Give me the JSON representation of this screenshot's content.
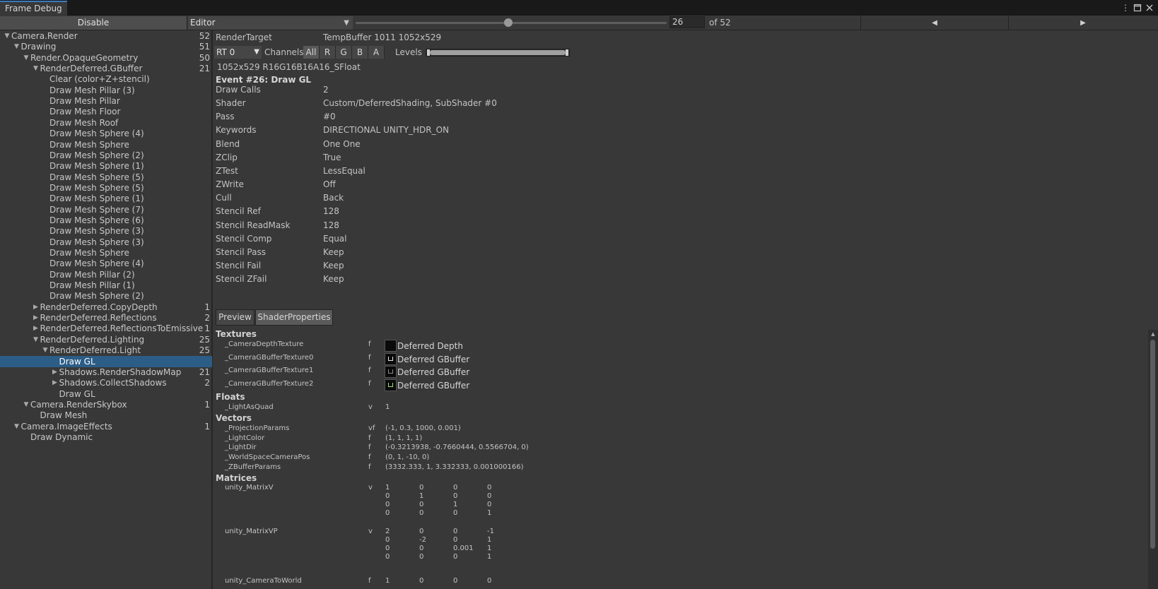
{
  "window": {
    "tab_title": "Frame Debug",
    "icons": [
      "more-vert-icon",
      "maximize-icon",
      "close-icon"
    ]
  },
  "toolbar": {
    "disable_label": "Disable",
    "target_value": "Editor",
    "event_value": "26",
    "event_of": "of 52",
    "slider_fraction": 0.5
  },
  "tree": [
    {
      "label": "Camera.Render",
      "count": "52",
      "depth": 0,
      "arrow": "down"
    },
    {
      "label": "Drawing",
      "count": "51",
      "depth": 1,
      "arrow": "down"
    },
    {
      "label": "Render.OpaqueGeometry",
      "count": "50",
      "depth": 2,
      "arrow": "down"
    },
    {
      "label": "RenderDeferred.GBuffer",
      "count": "21",
      "depth": 3,
      "arrow": "down"
    },
    {
      "label": "Clear (color+Z+stencil)",
      "count": "",
      "depth": 4,
      "arrow": ""
    },
    {
      "label": "Draw Mesh Pillar (3)",
      "count": "",
      "depth": 4,
      "arrow": ""
    },
    {
      "label": "Draw Mesh Pillar",
      "count": "",
      "depth": 4,
      "arrow": ""
    },
    {
      "label": "Draw Mesh Floor",
      "count": "",
      "depth": 4,
      "arrow": ""
    },
    {
      "label": "Draw Mesh Roof",
      "count": "",
      "depth": 4,
      "arrow": ""
    },
    {
      "label": "Draw Mesh Sphere (4)",
      "count": "",
      "depth": 4,
      "arrow": ""
    },
    {
      "label": "Draw Mesh Sphere",
      "count": "",
      "depth": 4,
      "arrow": ""
    },
    {
      "label": "Draw Mesh Sphere (2)",
      "count": "",
      "depth": 4,
      "arrow": ""
    },
    {
      "label": "Draw Mesh Sphere (1)",
      "count": "",
      "depth": 4,
      "arrow": ""
    },
    {
      "label": "Draw Mesh Sphere (5)",
      "count": "",
      "depth": 4,
      "arrow": ""
    },
    {
      "label": "Draw Mesh Sphere (5)",
      "count": "",
      "depth": 4,
      "arrow": ""
    },
    {
      "label": "Draw Mesh Sphere (1)",
      "count": "",
      "depth": 4,
      "arrow": ""
    },
    {
      "label": "Draw Mesh Sphere (7)",
      "count": "",
      "depth": 4,
      "arrow": ""
    },
    {
      "label": "Draw Mesh Sphere (6)",
      "count": "",
      "depth": 4,
      "arrow": ""
    },
    {
      "label": "Draw Mesh Sphere (3)",
      "count": "",
      "depth": 4,
      "arrow": ""
    },
    {
      "label": "Draw Mesh Sphere (3)",
      "count": "",
      "depth": 4,
      "arrow": ""
    },
    {
      "label": "Draw Mesh Sphere",
      "count": "",
      "depth": 4,
      "arrow": ""
    },
    {
      "label": "Draw Mesh Sphere (4)",
      "count": "",
      "depth": 4,
      "arrow": ""
    },
    {
      "label": "Draw Mesh Pillar (2)",
      "count": "",
      "depth": 4,
      "arrow": ""
    },
    {
      "label": "Draw Mesh Pillar (1)",
      "count": "",
      "depth": 4,
      "arrow": ""
    },
    {
      "label": "Draw Mesh Sphere (2)",
      "count": "",
      "depth": 4,
      "arrow": ""
    },
    {
      "label": "RenderDeferred.CopyDepth",
      "count": "1",
      "depth": 3,
      "arrow": "right"
    },
    {
      "label": "RenderDeferred.Reflections",
      "count": "2",
      "depth": 3,
      "arrow": "right"
    },
    {
      "label": "RenderDeferred.ReflectionsToEmissive",
      "count": "1",
      "depth": 3,
      "arrow": "right"
    },
    {
      "label": "RenderDeferred.Lighting",
      "count": "25",
      "depth": 3,
      "arrow": "down"
    },
    {
      "label": "RenderDeferred.Light",
      "count": "25",
      "depth": 4,
      "arrow": "down"
    },
    {
      "label": "Draw GL",
      "count": "",
      "depth": 5,
      "arrow": "",
      "selected": true
    },
    {
      "label": "Shadows.RenderShadowMap",
      "count": "21",
      "depth": 5,
      "arrow": "right"
    },
    {
      "label": "Shadows.CollectShadows",
      "count": "2",
      "depth": 5,
      "arrow": "right"
    },
    {
      "label": "Draw GL",
      "count": "",
      "depth": 5,
      "arrow": ""
    },
    {
      "label": "Camera.RenderSkybox",
      "count": "1",
      "depth": 2,
      "arrow": "down"
    },
    {
      "label": "Draw Mesh",
      "count": "",
      "depth": 3,
      "arrow": ""
    },
    {
      "label": "Camera.ImageEffects",
      "count": "1",
      "depth": 1,
      "arrow": "down"
    },
    {
      "label": "Draw Dynamic",
      "count": "",
      "depth": 2,
      "arrow": ""
    }
  ],
  "details": {
    "render_target_label": "RenderTarget",
    "render_target_value": "TempBuffer 1011 1052x529",
    "rt_select": "RT 0",
    "channels_label": "Channels",
    "channels": [
      "All",
      "R",
      "G",
      "B",
      "A"
    ],
    "levels_label": "Levels",
    "format": "1052x529 R16G16B16A16_SFloat",
    "event_title": "Event #26: Draw GL",
    "props": [
      {
        "label": "Draw Calls",
        "value": "2"
      },
      {
        "label": "Shader",
        "value": "Custom/DeferredShading, SubShader #0"
      },
      {
        "label": "Pass",
        "value": "#0"
      },
      {
        "label": "Keywords",
        "value": "DIRECTIONAL UNITY_HDR_ON"
      },
      {
        "label": "Blend",
        "value": "One One"
      },
      {
        "label": "ZClip",
        "value": "True"
      },
      {
        "label": "ZTest",
        "value": "LessEqual"
      },
      {
        "label": "ZWrite",
        "value": "Off"
      },
      {
        "label": "Cull",
        "value": "Back"
      },
      {
        "label": "Stencil Ref",
        "value": "128"
      },
      {
        "label": "Stencil ReadMask",
        "value": "128"
      },
      {
        "label": "Stencil Comp",
        "value": "Equal"
      },
      {
        "label": "Stencil Pass",
        "value": "Keep"
      },
      {
        "label": "Stencil Fail",
        "value": "Keep"
      },
      {
        "label": "Stencil ZFail",
        "value": "Keep"
      }
    ],
    "tabs": [
      {
        "label": "Preview",
        "active": false
      },
      {
        "label": "ShaderProperties",
        "active": true
      }
    ]
  },
  "shader_props": {
    "textures_title": "Textures",
    "textures": [
      {
        "name": "_CameraDepthTexture",
        "type": "f",
        "value": "Deferred Depth",
        "thumb": "dark"
      },
      {
        "name": "_CameraGBufferTexture0",
        "type": "f",
        "value": "Deferred GBuffer",
        "thumb": "white"
      },
      {
        "name": "_CameraGBufferTexture1",
        "type": "f",
        "value": "Deferred GBuffer",
        "thumb": "grey"
      },
      {
        "name": "_CameraGBufferTexture2",
        "type": "f",
        "value": "Deferred GBuffer",
        "thumb": "green"
      }
    ],
    "floats_title": "Floats",
    "floats": [
      {
        "name": "_LightAsQuad",
        "type": "v",
        "value": "1"
      }
    ],
    "vectors_title": "Vectors",
    "vectors": [
      {
        "name": "_ProjectionParams",
        "type": "vf",
        "value": "(-1, 0.3, 1000, 0.001)"
      },
      {
        "name": "_LightColor",
        "type": "f",
        "value": "(1, 1, 1, 1)"
      },
      {
        "name": "_LightDir",
        "type": "f",
        "value": "(-0.3213938, -0.7660444, 0.5566704, 0)"
      },
      {
        "name": "_WorldSpaceCameraPos",
        "type": "f",
        "value": "(0, 1, -10, 0)"
      },
      {
        "name": "_ZBufferParams",
        "type": "f",
        "value": "(3332.333, 1, 3.332333, 0.001000166)"
      }
    ],
    "matrices_title": "Matrices",
    "matrices": [
      {
        "name": "unity_MatrixV",
        "type": "v",
        "rows": [
          [
            "1",
            "0",
            "0",
            "0"
          ],
          [
            "0",
            "1",
            "0",
            "0"
          ],
          [
            "0",
            "0",
            "1",
            "0"
          ],
          [
            "0",
            "0",
            "0",
            "1"
          ]
        ]
      },
      {
        "name": "unity_MatrixVP",
        "type": "v",
        "rows": [
          [
            "2",
            "0",
            "0",
            "-1"
          ],
          [
            "0",
            "-2",
            "0",
            "1"
          ],
          [
            "0",
            "0",
            "0.001",
            "1"
          ],
          [
            "0",
            "0",
            "0",
            "1"
          ]
        ]
      },
      {
        "name": "unity_CameraToWorld",
        "type": "f",
        "rows": [
          [
            "1",
            "0",
            "0",
            "0"
          ]
        ]
      }
    ]
  },
  "colors": {
    "selection": "#2c5d87",
    "tab_accent": "#3a79bb",
    "panel_bg": "#383838"
  }
}
